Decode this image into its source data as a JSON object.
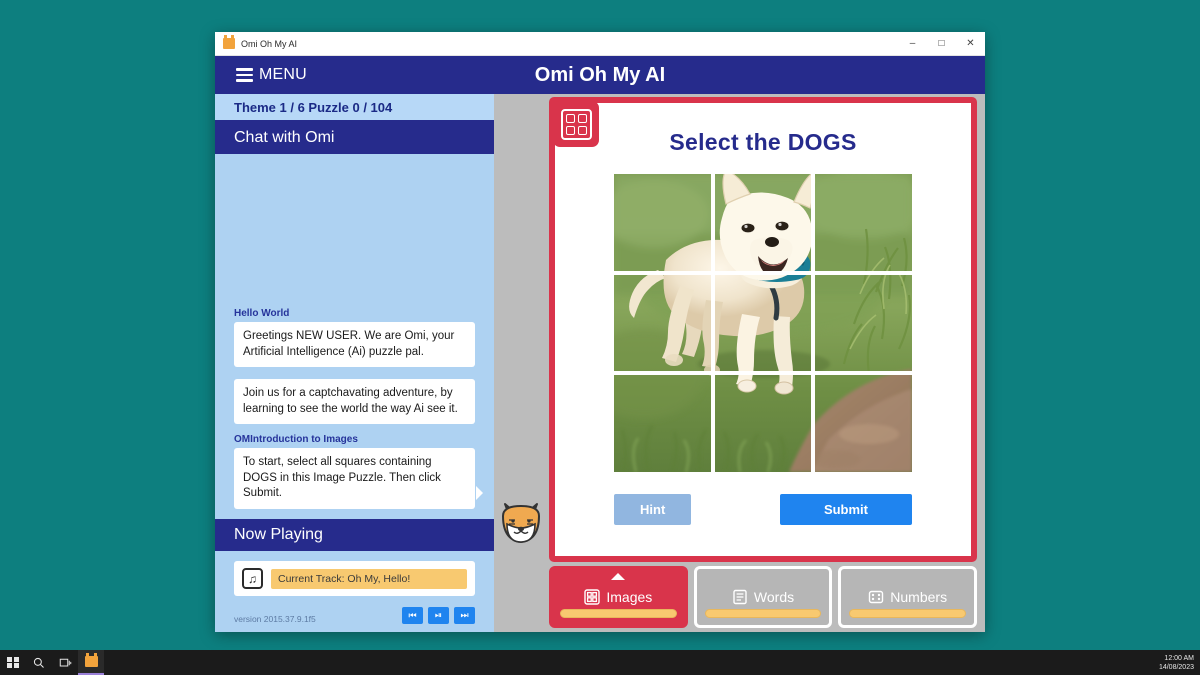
{
  "taskbar": {
    "start_icon": "windows-logo-icon",
    "search_icon": "search-icon",
    "taskview_icon": "task-view-icon",
    "app_icon": "omi-app-icon",
    "clock_time": "12:00 AM",
    "clock_date": "14/08/2023"
  },
  "window": {
    "titlebar_text": "Omi Oh My AI",
    "minimize": "–",
    "maximize": "□",
    "close": "✕"
  },
  "header": {
    "menu_label": "MENU",
    "app_title": "Omi Oh My AI"
  },
  "sidebar": {
    "theme_status": "Theme 1 / 6 Puzzle 0 / 104",
    "chat_header": "Chat with Omi",
    "messages": [
      {
        "label": "Hello World",
        "text": "Greetings NEW USER. We are Omi, your Artificial Intelligence (Ai) puzzle pal.",
        "tail": false
      },
      {
        "label": "",
        "text": "Join us for a captchavating adventure, by learning to see the world the way Ai see it.",
        "tail": false
      },
      {
        "label": "OMIntroduction to Images",
        "text": "To start, select all squares containing DOGS in this Image Puzzle. Then click Submit.",
        "tail": true
      }
    ],
    "now_playing_header": "Now Playing",
    "track_name": "Current Track: Oh My, Hello!",
    "track_icon": "music-note-icon",
    "version": "version 2015.37.9.1f5",
    "player_controls": [
      {
        "name": "previous-track-button",
        "glyph": "⏮"
      },
      {
        "name": "play-pause-button",
        "glyph": "⏯"
      },
      {
        "name": "next-track-button",
        "glyph": "⏭"
      }
    ]
  },
  "mascot": {
    "name": "omi-mascot-fox-face",
    "fur_color": "#f0a950",
    "outline_color": "#333333"
  },
  "puzzle": {
    "badge_icon": "grid-2x2-icon",
    "title": "Select the DOGS",
    "subject": "dog running on grass",
    "grid_rows": 3,
    "grid_cols": 3,
    "hint_label": "Hint",
    "submit_label": "Submit",
    "accent_color": "#d9344b"
  },
  "tabs": [
    {
      "label": "Images",
      "icon": "grid-2x2-icon",
      "active": true,
      "progress": 100
    },
    {
      "label": "Words",
      "icon": "document-lines-icon",
      "active": false,
      "progress": 100
    },
    {
      "label": "Numbers",
      "icon": "dice-dots-icon",
      "active": false,
      "progress": 100
    }
  ]
}
